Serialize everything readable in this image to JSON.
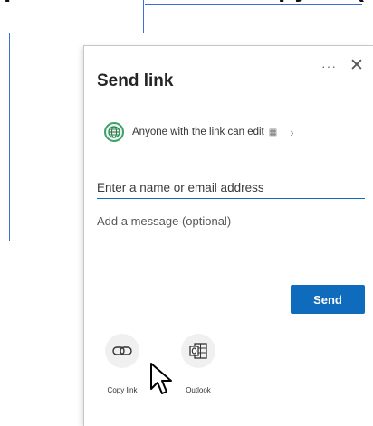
{
  "background": {
    "heading_fragment": "p       copy"
  },
  "dialog": {
    "title": "Send link",
    "more_glyph": "···",
    "close_glyph": "✕",
    "permission": {
      "text": "Anyone with the link can edit",
      "calendar_glyph": "▦",
      "chevron_glyph": "›"
    },
    "name_field": {
      "placeholder": "Enter a name or email address",
      "value": ""
    },
    "message_field": {
      "placeholder": "Add a message (optional)",
      "value": ""
    },
    "send_label": "Send",
    "share_options": [
      {
        "label": "Copy link",
        "icon": "link-icon"
      },
      {
        "label": "Outlook",
        "icon": "outlook-icon"
      }
    ]
  },
  "colors": {
    "accent": "#0f6cbd",
    "connector": "#3b6fd4",
    "globe": "#3fa06a"
  }
}
